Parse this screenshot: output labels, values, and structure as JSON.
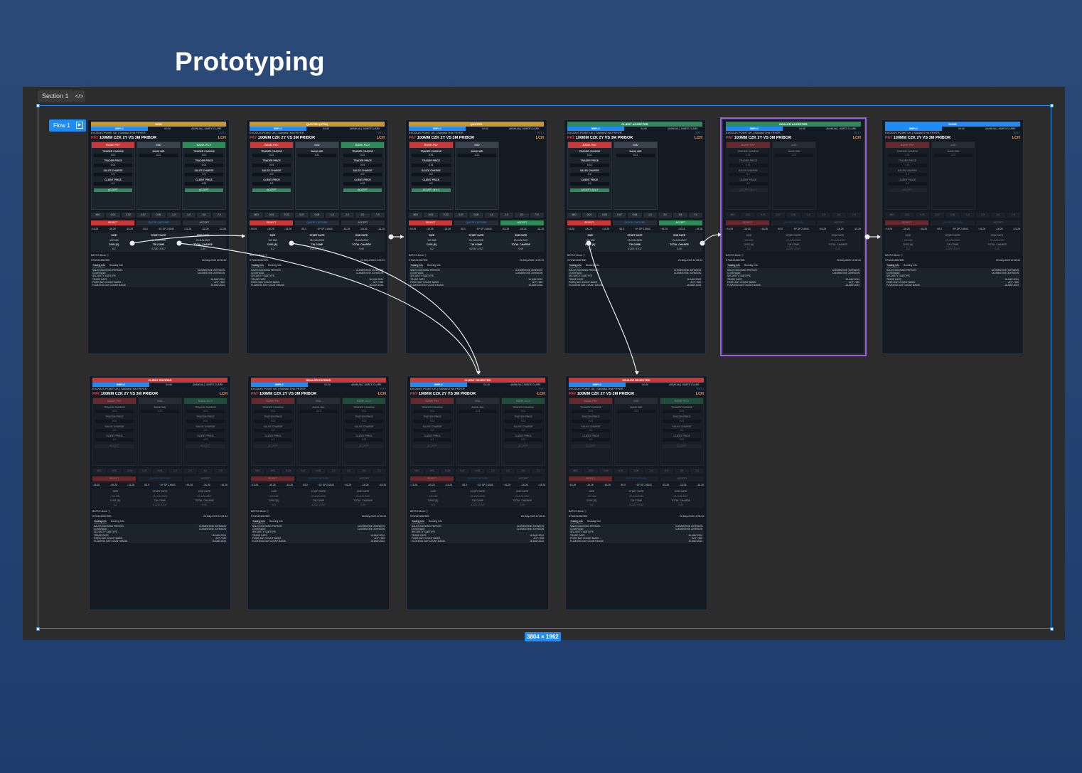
{
  "page_title": "Prototyping",
  "section_label": "Section 1",
  "code_label": "</>",
  "flow_label": "Flow 1",
  "dimensions": "3804 × 1962",
  "common": {
    "venue": "BBPLC",
    "time": "04:40",
    "owner": "(MANUAL) JAMES CLARK",
    "client": "EXODUS POINT UK",
    "trader": "SAMANTHA FRYER",
    "tgt": "TGT !",
    "side": "PAY",
    "instrument": "100MM CZK 2Y VS 3M PRIBOR",
    "clearing": "LCH",
    "bank_pay": "BANK PAY",
    "mid": "MID",
    "bank_rcv": "BANK RCV",
    "trader_charge": "TRADER CHARGE",
    "trader_charge_val": "0.01",
    "bank_mid": "BANK MID",
    "bank_mid_val": "4.21",
    "trader_price": "TRADER PRICE",
    "trader_price_val": "0.01",
    "sales_charge": "SALES CHARGE",
    "sales_charge_val": "0.0",
    "client_price": "CLIENT PRICE",
    "client_price_pay": "4.2",
    "client_price_rcv": "4.22",
    "accept": "ACCEPT",
    "accept_at": "ACCEPT @ 4.2",
    "ticks": [
      "MID",
      "0.01",
      "0.03",
      "0.07",
      "0.08",
      "1.0",
      "2.0",
      "3.0",
      "7.0"
    ],
    "reject": "REJECT",
    "quote_capture": "QUOTE CAPTURE",
    "stats": [
      "↑16.26",
      "↓16.26",
      "↓16.26",
      "60.0",
      "↑5Y SP 2.6543",
      "↑16.26",
      "↓16.26",
      "↓16.26"
    ],
    "size": "SIZE",
    "size_val": "100 MM",
    "start_date": "START DATE",
    "start_date_val": "25-JUN-2025",
    "end_date": "END DATE",
    "end_date_val": "23-JUN-2027",
    "dv01": "DV01 (K)",
    "dv01_val": "6.2",
    "tw_comp": "TW COMP",
    "tw_comp_val": "4.225 / 4.017",
    "total_charge": "TOTAL CHARGE",
    "total_charge_val": "0.40",
    "book": "BATS E-Book ⓘ",
    "id": "STW1234567890",
    "timestamp": "20-May-2025 12:05:34",
    "tab_trading": "Trading Info",
    "tab_booking": "Booking Info",
    "info_rows": [
      [
        "SALES BOOKING PERSON",
        "CLEMENTINE JOHNSON"
      ],
      [
        "COVERAGE",
        "CLEMENTINE JOHNSON"
      ],
      [
        "SECURITY SUBTYPE",
        ""
      ],
      [
        "TRADE DATE",
        "16-MAY-2024"
      ],
      [
        "FIXED DAY COUNT BASIS",
        "ACT / 360"
      ],
      [
        "FLOATING DAY COUNT BASIS",
        "16-MAY-2024"
      ]
    ]
  },
  "frames": [
    {
      "status": "NEW",
      "color": "#c8962a"
    },
    {
      "status": "QUOTED (OTW)",
      "color": "#c8962a"
    },
    {
      "status": "QUOTED",
      "color": "#c8962a"
    },
    {
      "status": "CLIENT ACCEPTED",
      "color": "#2e8b57"
    },
    {
      "status": "DEALER ACCEPTED",
      "color": "#2e8b57"
    },
    {
      "status": "DONE",
      "color": "#1f8bf5"
    },
    {
      "status": "CLIENT EXPIRED",
      "color": "#c83a3a"
    },
    {
      "status": "DEALER EXPIRED",
      "color": "#c83a3a"
    },
    {
      "status": "CLIENT REJECTED",
      "color": "#c83a3a"
    },
    {
      "status": "DEALER REJECTED",
      "color": "#c83a3a"
    }
  ],
  "colors": {
    "accent": "#1f8bf5",
    "selection": "#9b5de5",
    "pay": "#c83a3a",
    "rcv": "#2e8b57",
    "quoted": "#c8962a"
  }
}
